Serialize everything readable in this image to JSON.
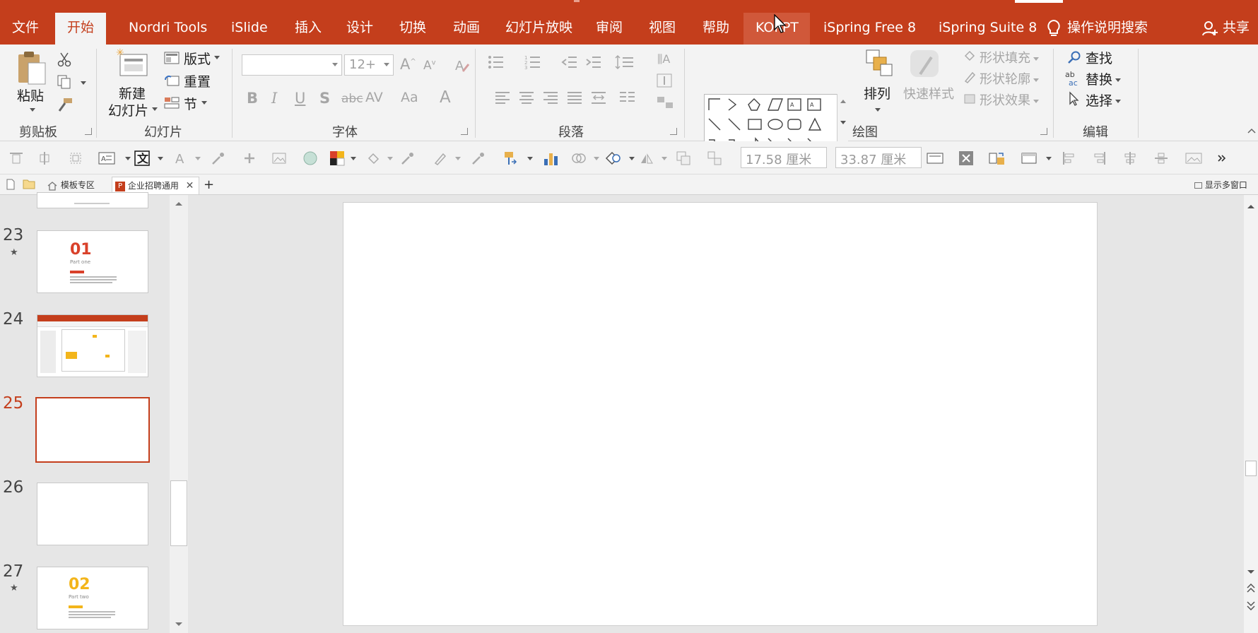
{
  "ribbon_tabs": [
    "文件",
    "开始",
    "Nordri Tools",
    "iSlide",
    "插入",
    "设计",
    "切换",
    "动画",
    "幻灯片放映",
    "审阅",
    "视图",
    "帮助",
    "KOPPT",
    "iSpring Free 8",
    "iSpring Suite 8"
  ],
  "active_tab": "开始",
  "search_label": "操作说明搜索",
  "share_label": "共享",
  "clipboard": {
    "paste": "粘贴",
    "group": "剪贴板"
  },
  "slides_group": {
    "new_slide_1": "新建",
    "new_slide_2": "幻灯片",
    "layout": "版式",
    "reset": "重置",
    "section": "节",
    "group": "幻灯片"
  },
  "font_group": {
    "font_name": "",
    "font_size": "12+",
    "group": "字体",
    "bold": "B",
    "italic": "I",
    "underline": "U",
    "shadow": "S",
    "strike": "abc",
    "spacing": "AV",
    "case": "Aa",
    "color": "A"
  },
  "paragraph_group": {
    "group": "段落"
  },
  "drawing_group": {
    "arrange": "排列",
    "quick_styles": "快速样式",
    "shape_fill": "形状填充",
    "shape_outline": "形状轮廓",
    "shape_effects": "形状效果",
    "group": "绘图"
  },
  "editing_group": {
    "find": "查找",
    "replace": "替换",
    "select": "选择",
    "group": "编辑"
  },
  "size": {
    "height": "17.58 厘米",
    "width": "33.87 厘米"
  },
  "doc_tabs": {
    "template": "模板专区",
    "current": "企业招聘通用",
    "new_tab": "+",
    "multi_window": "显示多窗口"
  },
  "slides": [
    {
      "num": "23",
      "starred": true,
      "title": "01",
      "sub": "Part one",
      "accent": "#d9412a"
    },
    {
      "num": "24",
      "starred": false
    },
    {
      "num": "25",
      "starred": false,
      "selected": true
    },
    {
      "num": "26",
      "starred": false
    },
    {
      "num": "27",
      "starred": true,
      "title": "02",
      "sub": "Part two",
      "accent": "#f3b51b"
    }
  ],
  "colors": {
    "accent": "#c43e1c",
    "ribbon_bg": "#f3f3f3",
    "canvas_bg": "#e6e6e6"
  }
}
